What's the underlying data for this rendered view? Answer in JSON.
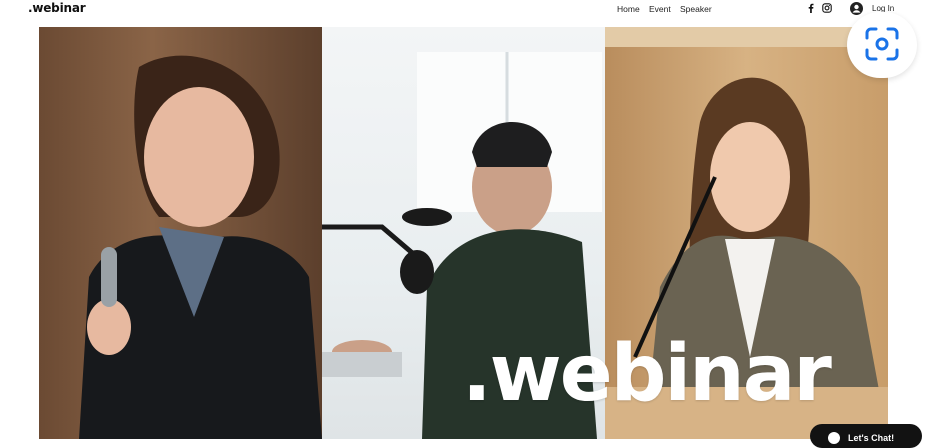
{
  "header": {
    "logo": ".webinar",
    "nav": [
      "Home",
      "Event",
      "Speaker"
    ],
    "social": [
      "facebook-icon",
      "instagram-icon"
    ],
    "login": "Log In"
  },
  "hero": {
    "title": ".webinar",
    "panels": [
      "speaker-woman-microphone",
      "speaker-man-podcast-mic",
      "speaker-woman-podium"
    ]
  },
  "chat": {
    "label": "Let's Chat!"
  },
  "colors": {
    "text": "#111111",
    "chat_bg": "#121212",
    "lens_accent": "#1a73e8"
  }
}
